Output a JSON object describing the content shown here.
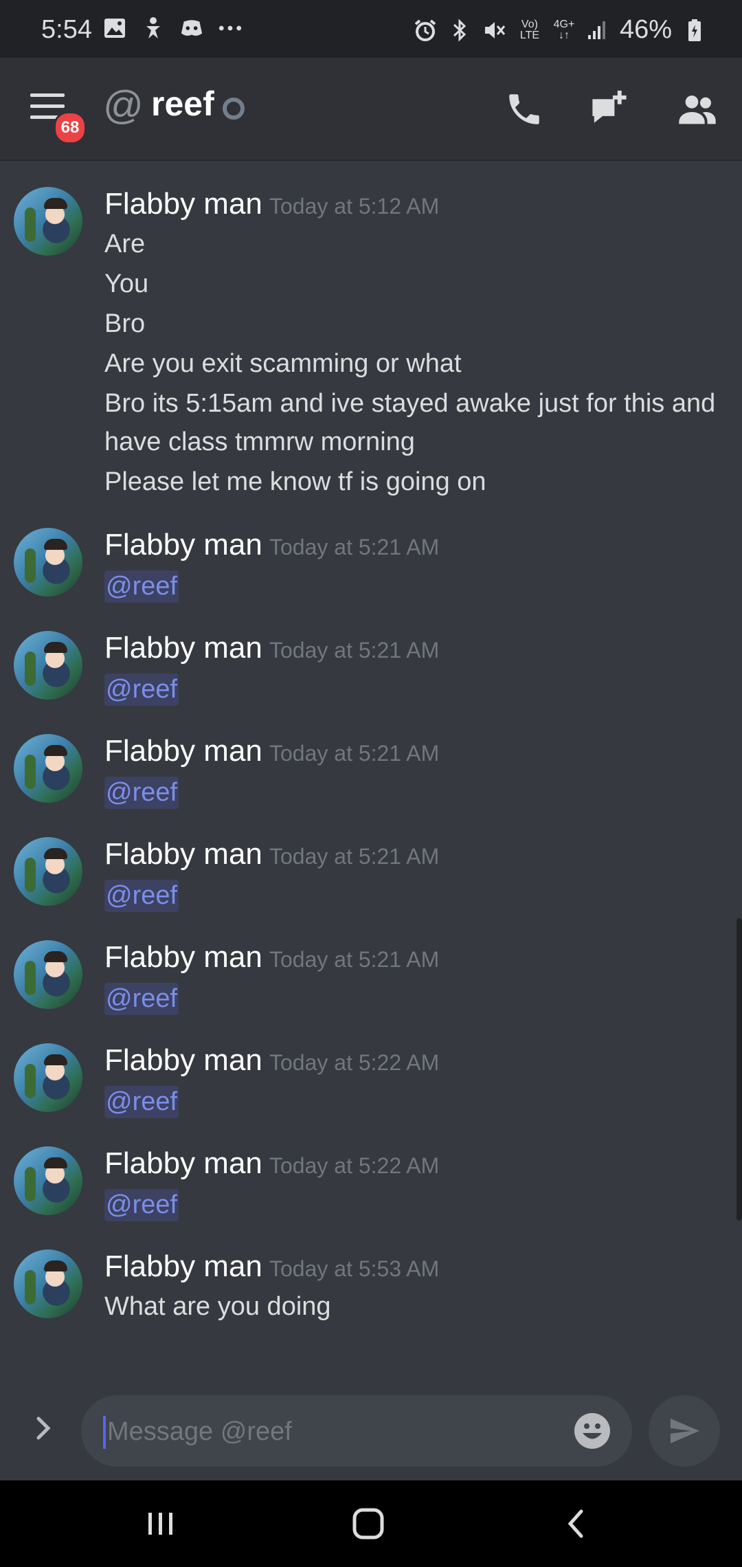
{
  "status_bar": {
    "time": "5:54",
    "left_icons": [
      "gallery-icon",
      "accessibility-icon",
      "discord-icon",
      "more-icon"
    ],
    "right_icons": [
      "alarm-icon",
      "bluetooth-icon",
      "mute-icon",
      "volte-icon",
      "4g-icon",
      "signal-icon"
    ],
    "battery": "46%"
  },
  "header": {
    "menu_badge": "68",
    "channel_prefix": "@",
    "channel_name": "reef"
  },
  "messages": [
    {
      "author": "Flabby man",
      "timestamp": "Today at 5:12 AM",
      "lines": [
        "Are",
        "You",
        "Bro",
        "Are you exit scamming or what",
        "Bro its 5:15am and ive stayed awake just for this and",
        "have class tmmrw morning",
        "Please let me know tf is going on"
      ]
    },
    {
      "author": "Flabby man",
      "timestamp": "Today at 5:21 AM",
      "mention": "@reef"
    },
    {
      "author": "Flabby man",
      "timestamp": "Today at 5:21 AM",
      "mention": "@reef"
    },
    {
      "author": "Flabby man",
      "timestamp": "Today at 5:21 AM",
      "mention": "@reef"
    },
    {
      "author": "Flabby man",
      "timestamp": "Today at 5:21 AM",
      "mention": "@reef"
    },
    {
      "author": "Flabby man",
      "timestamp": "Today at 5:21 AM",
      "mention": "@reef"
    },
    {
      "author": "Flabby man",
      "timestamp": "Today at 5:22 AM",
      "mention": "@reef"
    },
    {
      "author": "Flabby man",
      "timestamp": "Today at 5:22 AM",
      "mention": "@reef"
    },
    {
      "author": "Flabby man",
      "timestamp": "Today at 5:53 AM",
      "lines": [
        "What are you doing"
      ]
    }
  ],
  "composer": {
    "placeholder": "Message @reef"
  },
  "colors": {
    "background": "#36393f",
    "header": "#2f3136",
    "mention": "#7b8fe8",
    "badge": "#ed4245"
  }
}
